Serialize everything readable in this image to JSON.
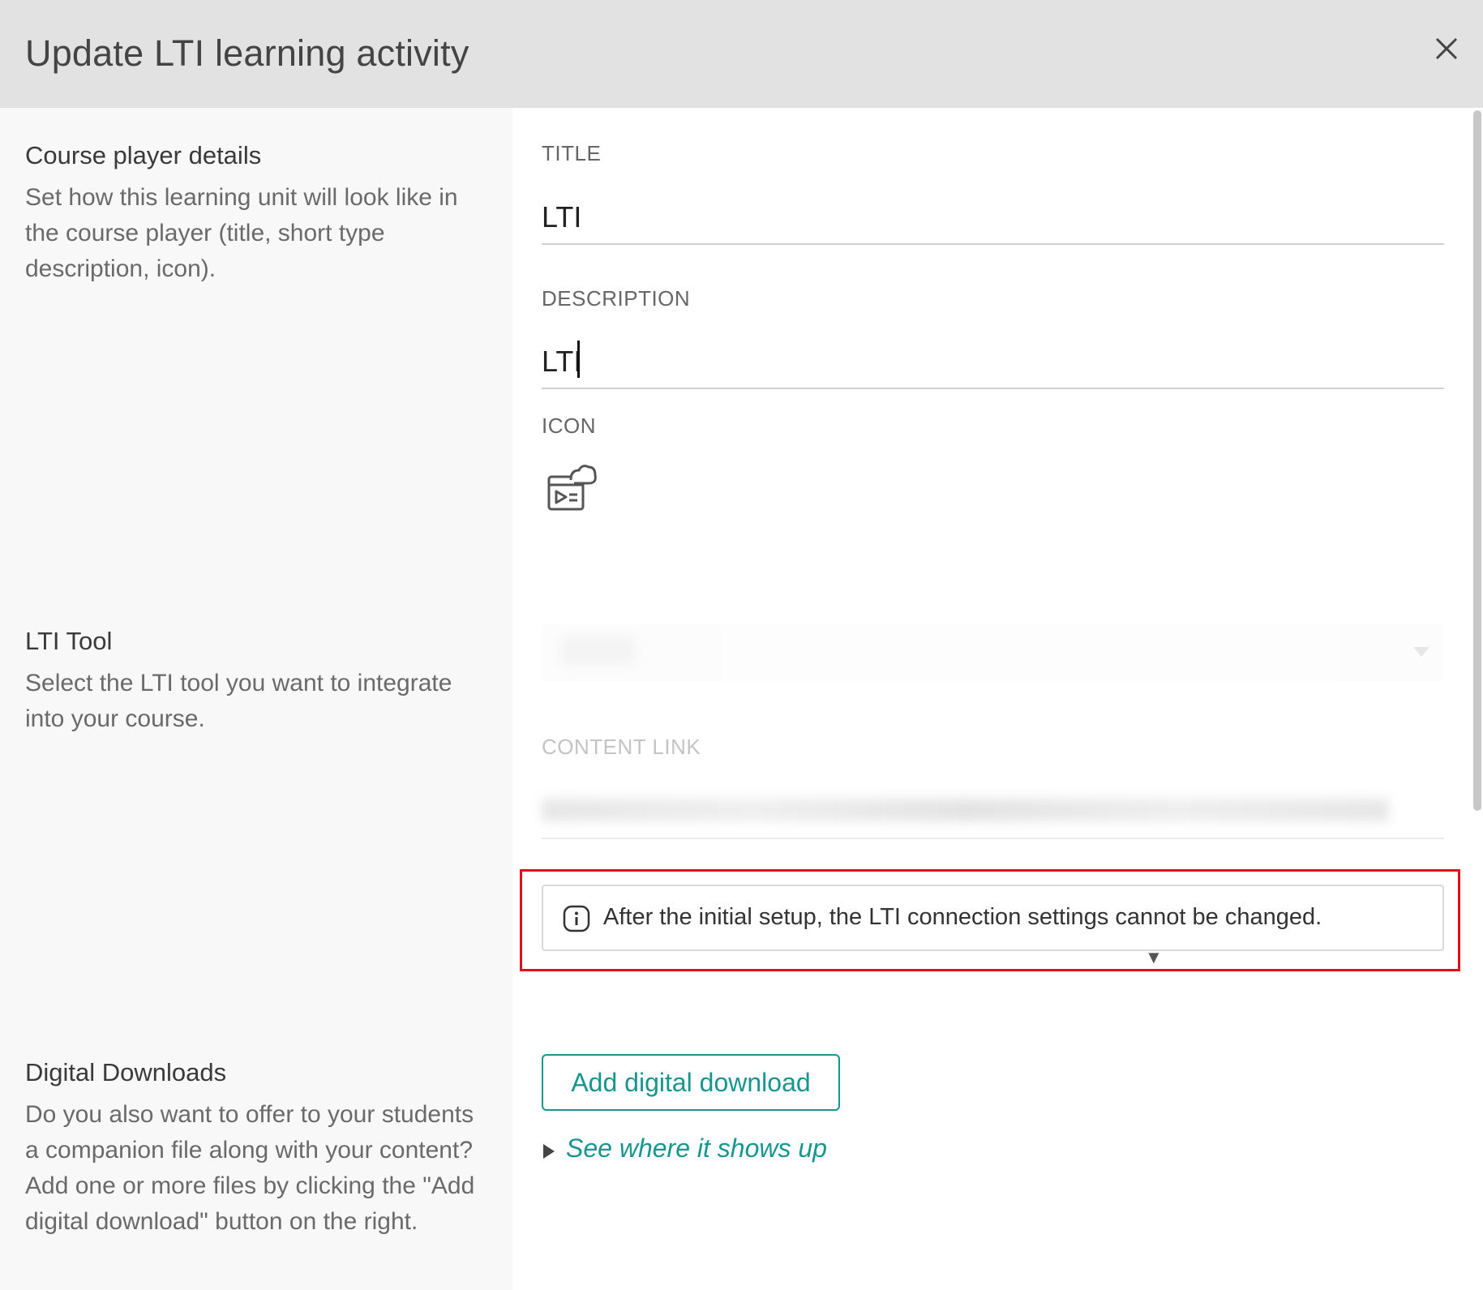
{
  "header": {
    "title": "Update LTI learning activity",
    "close_icon": "close-icon"
  },
  "sections": {
    "course_player": {
      "title": "Course player details",
      "description": "Set how this learning unit will look like in the course player (title, short type description, icon)."
    },
    "lti_tool": {
      "title": "LTI Tool",
      "description": "Select the LTI tool you want to integrate into your course."
    },
    "digital_downloads": {
      "title": "Digital Downloads",
      "description": "Do you also want to offer to your students a companion file along with your content? Add one or more files by clicking the \"Add digital download\" button on the right."
    }
  },
  "form": {
    "title_label": "TITLE",
    "title_value": "LTI",
    "description_label": "DESCRIPTION",
    "description_value": "LTI",
    "icon_label": "ICON",
    "icon_name": "cloud-media-document-icon",
    "content_link_label": "CONTENT LINK"
  },
  "notice": {
    "icon": "info-icon",
    "text": "After the initial setup, the LTI connection settings cannot be changed."
  },
  "digital_download": {
    "button_label": "Add digital download",
    "see_where_label": "See where it shows up"
  },
  "colors": {
    "accent": "#17968f",
    "highlight": "#e0101a",
    "header_bg": "#e2e2e2",
    "sidebar_bg": "#f8f8f8"
  }
}
